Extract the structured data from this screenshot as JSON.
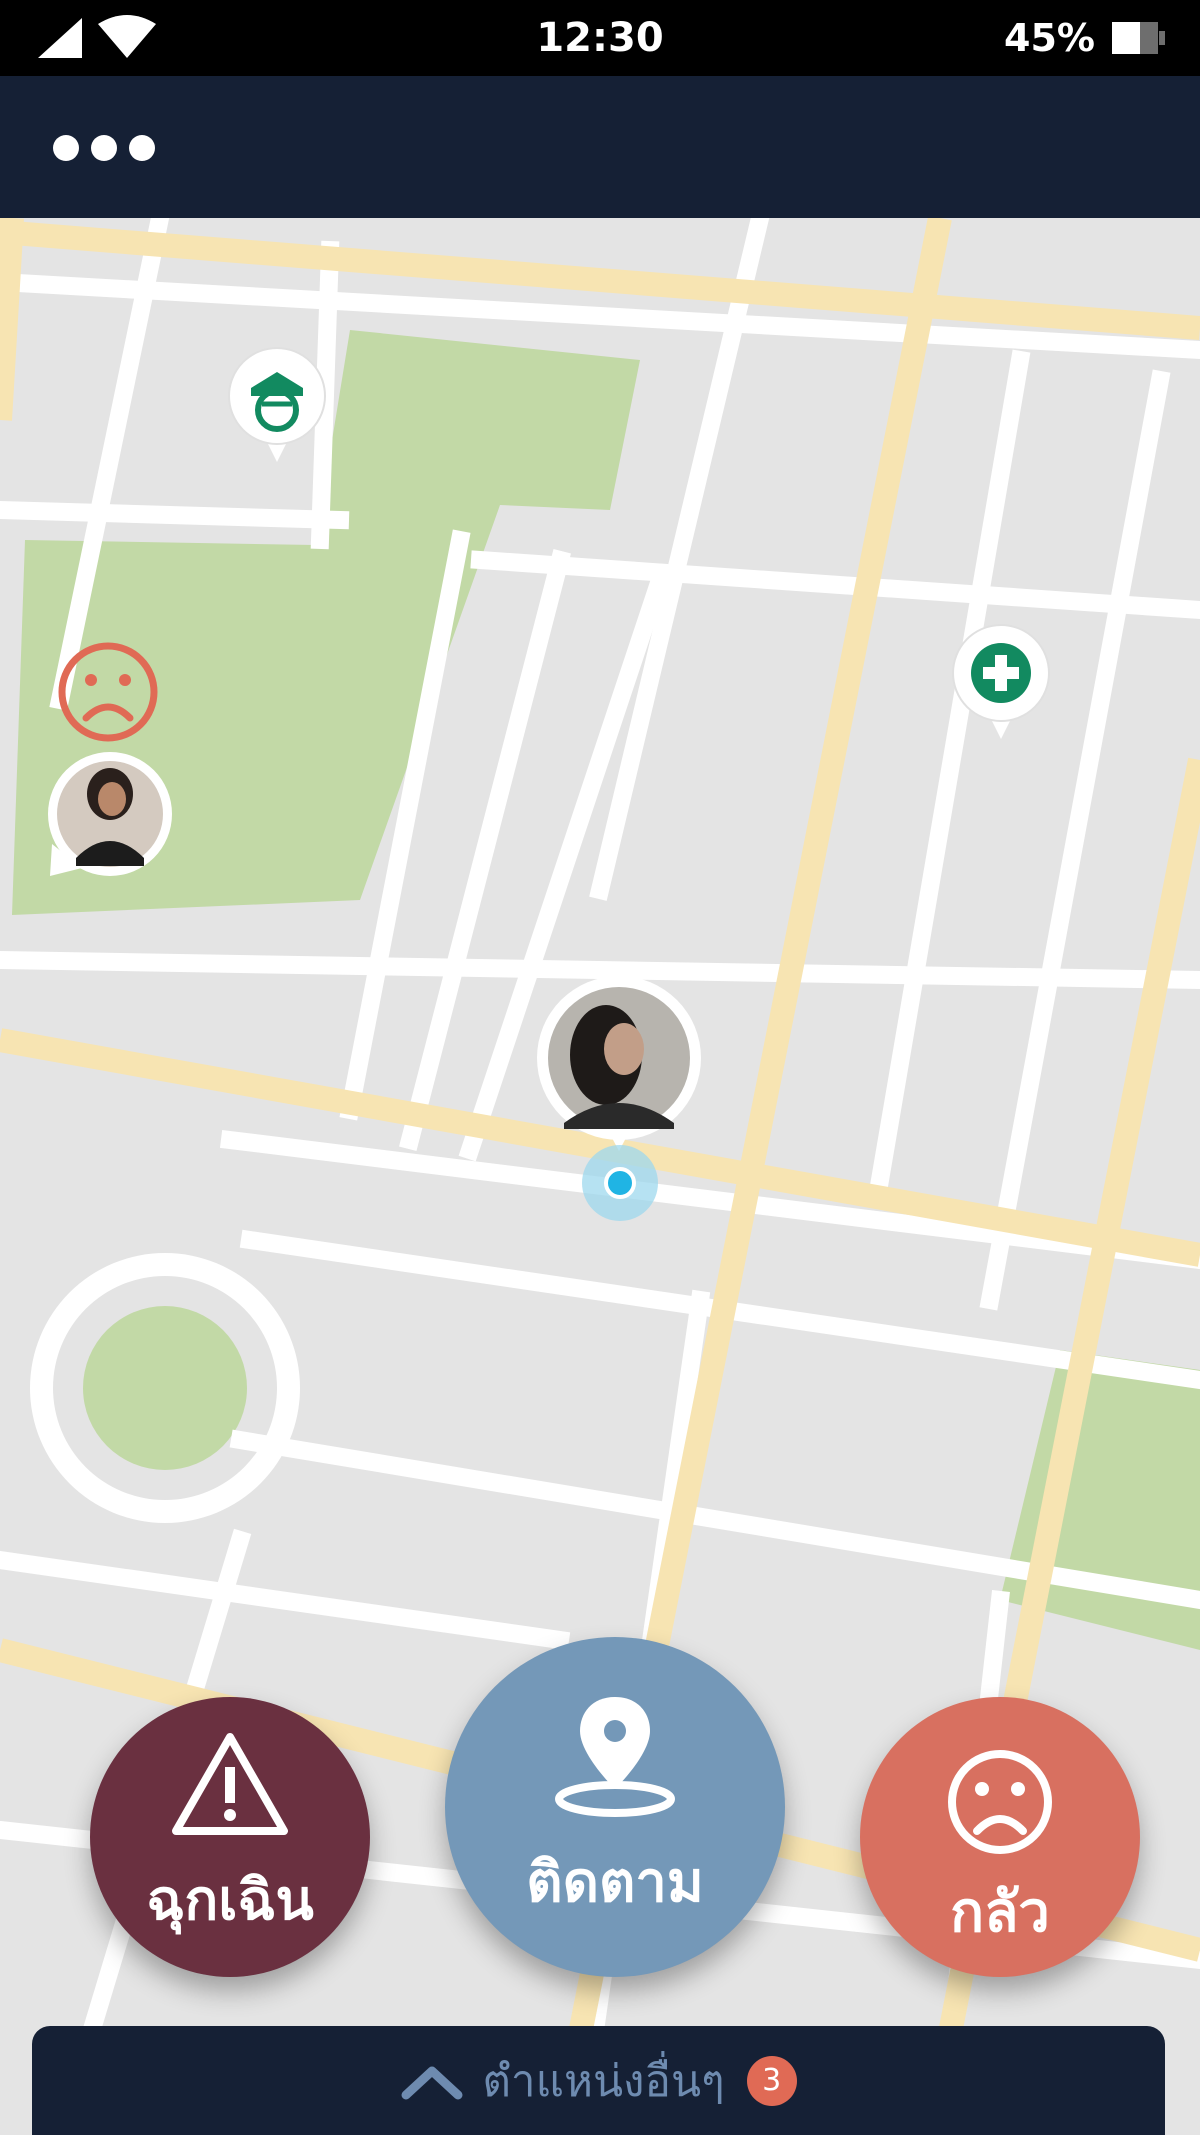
{
  "status_bar": {
    "time": "12:30",
    "battery": "45%",
    "icons": [
      "cellular-signal-icon",
      "wifi-icon",
      "battery-icon"
    ]
  },
  "header": {
    "menu_icon": "more-options-icon"
  },
  "map": {
    "markers": [
      {
        "kind": "police-station",
        "icon": "police-officer-icon"
      },
      {
        "kind": "hospital",
        "icon": "medical-cross-icon"
      },
      {
        "kind": "friend-scared",
        "icon": "sad-face-icon"
      },
      {
        "kind": "user-current-location",
        "icon": "location-dot-icon"
      }
    ]
  },
  "actions": {
    "emergency": {
      "label": "ฉุกเฉิน",
      "icon": "warning-triangle-icon",
      "color": "#6a3040"
    },
    "track": {
      "label": "ติดตาม",
      "icon": "location-pin-icon",
      "color": "#7498b8"
    },
    "afraid": {
      "label": "กลัว",
      "icon": "sad-face-icon",
      "color": "#d87060"
    }
  },
  "bottom_bar": {
    "label": "ตำแหน่งอื่นๆ",
    "count": "3",
    "icon": "chevron-up-icon"
  },
  "colors": {
    "header_bg": "#152035",
    "park_green": "#c2d9a6",
    "main_road": "#f7e4b2",
    "pin_green": "#128a60",
    "location_blue": "#20b4e4"
  }
}
